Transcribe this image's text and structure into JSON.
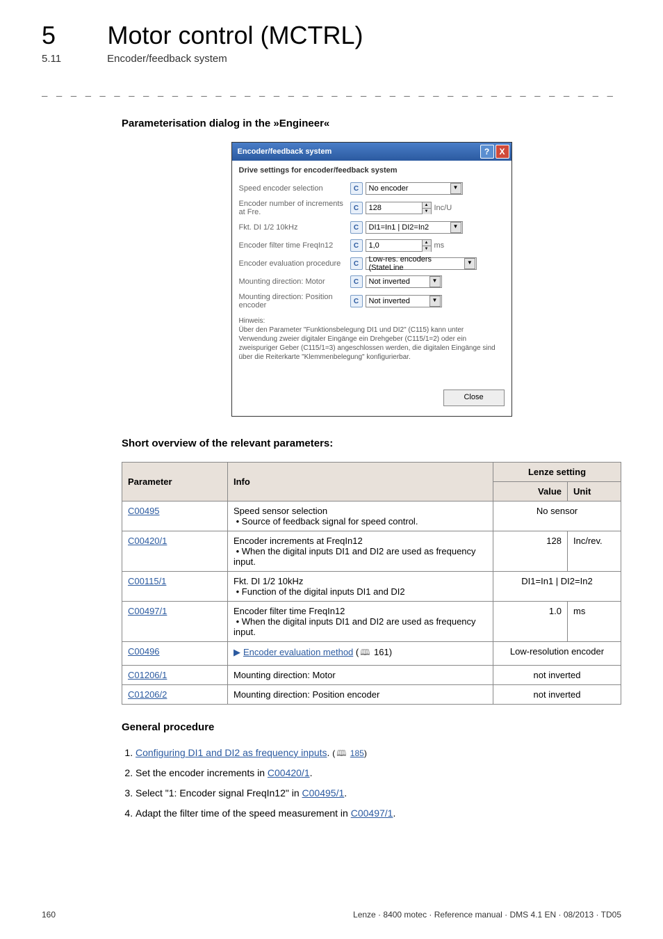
{
  "chapter": {
    "num": "5",
    "title": "Motor control (MCTRL)"
  },
  "section": {
    "num": "5.11",
    "title": "Encoder/feedback system"
  },
  "heading1": "Parameterisation dialog in the »Engineer«",
  "dialog": {
    "title": "Encoder/feedback system",
    "help": "?",
    "close": "X",
    "heading": "Drive settings for encoder/feedback system",
    "rows": {
      "speed_sel": {
        "label": "Speed encoder selection",
        "value": "No encoder"
      },
      "increments": {
        "label": "Encoder number of increments at Fre.",
        "value": "128",
        "unit": "Inc/U"
      },
      "fkt": {
        "label": "Fkt. DI 1/2 10kHz",
        "value": "DI1=In1 | DI2=In2"
      },
      "filter": {
        "label": "Encoder filter time FreqIn12",
        "value": "1,0",
        "unit": "ms"
      },
      "eval": {
        "label": "Encoder evaluation procedure",
        "value": "Low-res. encoders (StateLine"
      },
      "mountM": {
        "label": "Mounting direction: Motor",
        "value": "Not inverted"
      },
      "mountP": {
        "label": "Mounting direction: Position encoder",
        "value": "Not inverted"
      }
    },
    "hint_label": "Hinweis:",
    "hint": "Über den Parameter \"Funktionsbelegung DI1 und DI2\" (C115) kann unter Verwendung zweier digitaler Eingänge ein Drehgeber (C115/1=2) oder ein zweispuriger Geber (C115/1=3) angeschlossen werden, die digitalen Eingänge sind über die Reiterkarte \"Klemmenbelegung\" konfigurierbar.",
    "close_btn": "Close",
    "c": "C"
  },
  "heading2": "Short overview of the relevant parameters:",
  "table": {
    "headers": {
      "param": "Parameter",
      "info": "Info",
      "lenze": "Lenze setting",
      "value": "Value",
      "unit": "Unit"
    },
    "rows": [
      {
        "param": "C00495",
        "info_main": "Speed sensor selection",
        "info_sub": "Source of feedback signal for speed control.",
        "value": "No sensor",
        "unit": ""
      },
      {
        "param": "C00420/1",
        "info_main": "Encoder increments at FreqIn12",
        "info_sub": "When the digital inputs DI1 and DI2 are used as frequency input.",
        "value": "128",
        "unit": "Inc/rev."
      },
      {
        "param": "C00115/1",
        "info_main": "Fkt. DI 1/2 10kHz",
        "info_sub": "Function of the digital inputs DI1 and DI2",
        "value": "DI1=In1 | DI2=In2",
        "unit": ""
      },
      {
        "param": "C00497/1",
        "info_main": "Encoder filter time FreqIn12",
        "info_sub": "When the digital inputs DI1 and DI2 are used as frequency input.",
        "value": "1.0",
        "unit": "ms"
      },
      {
        "param": "C00496",
        "info_link": "Encoder evaluation method",
        "info_ref": "161",
        "value": "Low-resolution encoder",
        "unit": ""
      },
      {
        "param": "C01206/1",
        "info_main": "Mounting direction: Motor",
        "value": "not inverted",
        "unit": ""
      },
      {
        "param": "C01206/2",
        "info_main": "Mounting direction: Position encoder",
        "value": "not inverted",
        "unit": ""
      }
    ]
  },
  "heading3": "General procedure",
  "procedure": {
    "s1a": "Configuring DI1 and DI2 as frequency inputs",
    "s1b": "185",
    "s2a": "Set the encoder increments in ",
    "s2b": "C00420/1",
    "s3a": "Select \"1: Encoder signal FreqIn12\" in ",
    "s3b": "C00495/1",
    "s4a": "Adapt the filter time of the speed measurement in ",
    "s4b": "C00497/1"
  },
  "footer": {
    "page": "160",
    "info": "Lenze · 8400 motec · Reference manual · DMS 4.1 EN · 08/2013 · TD05"
  }
}
